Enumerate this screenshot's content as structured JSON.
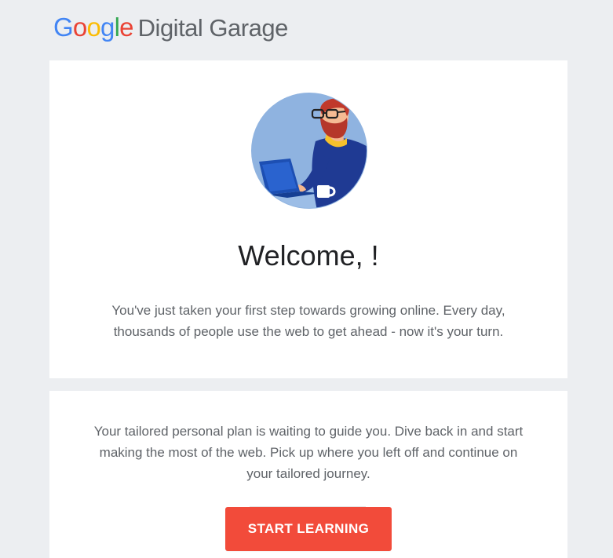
{
  "header": {
    "logo": {
      "google_letters": [
        {
          "char": "G",
          "color": "#4285F4"
        },
        {
          "char": "o",
          "color": "#EA4335"
        },
        {
          "char": "o",
          "color": "#FBBC05"
        },
        {
          "char": "g",
          "color": "#4285F4"
        },
        {
          "char": "l",
          "color": "#34A853"
        },
        {
          "char": "e",
          "color": "#EA4335"
        }
      ],
      "product_name": "Digital Garage"
    }
  },
  "welcome_card": {
    "avatar": "person-with-laptop-illustration",
    "title": "Welcome, !",
    "body": "You've just taken your first step towards growing online. Every day, thousands of people use the web to get ahead - now it's your turn."
  },
  "plan_card": {
    "body": "Your tailored personal plan is waiting to guide you. Dive back in and start making the most of the web. Pick up where you left off and continue on your tailored journey.",
    "cta_label": "START LEARNING",
    "cta_color": "#F24B3A"
  },
  "colors": {
    "background": "#ECEEF1",
    "card": "#FFFFFF",
    "heading": "#202124",
    "body_text": "#5F6368"
  }
}
